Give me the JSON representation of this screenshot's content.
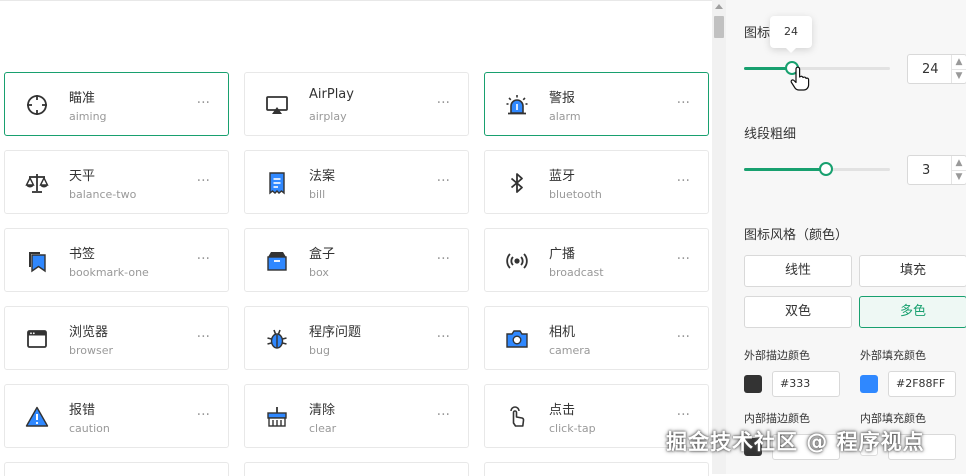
{
  "icons": [
    {
      "cn": "瞄准",
      "en": "aiming",
      "more": "···",
      "icon": "aiming-icon",
      "selected": true
    },
    {
      "cn": "AirPlay",
      "en": "airplay",
      "more": "···",
      "icon": "airplay-icon",
      "selected": false
    },
    {
      "cn": "警报",
      "en": "alarm",
      "more": "···",
      "icon": "alarm-icon",
      "selected": true
    },
    {
      "cn": "天平",
      "en": "balance-two",
      "more": "···",
      "icon": "balance-two-icon",
      "selected": false
    },
    {
      "cn": "法案",
      "en": "bill",
      "more": "···",
      "icon": "bill-icon",
      "selected": false
    },
    {
      "cn": "蓝牙",
      "en": "bluetooth",
      "more": "···",
      "icon": "bluetooth-icon",
      "selected": false
    },
    {
      "cn": "书签",
      "en": "bookmark-one",
      "more": "···",
      "icon": "bookmark-one-icon",
      "selected": false
    },
    {
      "cn": "盒子",
      "en": "box",
      "more": "···",
      "icon": "box-icon",
      "selected": false
    },
    {
      "cn": "广播",
      "en": "broadcast",
      "more": "···",
      "icon": "broadcast-icon",
      "selected": false
    },
    {
      "cn": "浏览器",
      "en": "browser",
      "more": "···",
      "icon": "browser-icon",
      "selected": false
    },
    {
      "cn": "程序问题",
      "en": "bug",
      "more": "···",
      "icon": "bug-icon",
      "selected": false
    },
    {
      "cn": "相机",
      "en": "camera",
      "more": "···",
      "icon": "camera-icon",
      "selected": false
    },
    {
      "cn": "报错",
      "en": "caution",
      "more": "···",
      "icon": "caution-icon",
      "selected": false
    },
    {
      "cn": "清除",
      "en": "clear",
      "more": "···",
      "icon": "clear-icon",
      "selected": false
    },
    {
      "cn": "点击",
      "en": "click-tap",
      "more": "···",
      "icon": "click-tap-icon",
      "selected": false
    }
  ],
  "panel": {
    "size_label": "图标",
    "size_value": "24",
    "size_tooltip": "24",
    "size_fraction": 0.33,
    "stroke_label": "线段粗细",
    "stroke_value": "3",
    "stroke_fraction": 0.56,
    "stepper_up": "▲",
    "stepper_down": "▼",
    "style_label": "图标风格（颜色）",
    "styles": [
      {
        "label": "线性",
        "active": false
      },
      {
        "label": "填充",
        "active": false
      },
      {
        "label": "双色",
        "active": false
      },
      {
        "label": "多色",
        "active": true
      }
    ],
    "colors": [
      {
        "label": "外部描边颜色",
        "hex": "#333"
      },
      {
        "label": "外部填充颜色",
        "hex": "#2F88FF"
      },
      {
        "label": "内部描边颜色",
        "hex": ""
      },
      {
        "label": "内部填充颜色",
        "hex": ""
      }
    ]
  },
  "watermark": "掘金技术社区 @ 程序视点",
  "colors": {
    "accent": "#18a06f",
    "icon_blue": "#2F88FF",
    "icon_dark": "#333333"
  }
}
